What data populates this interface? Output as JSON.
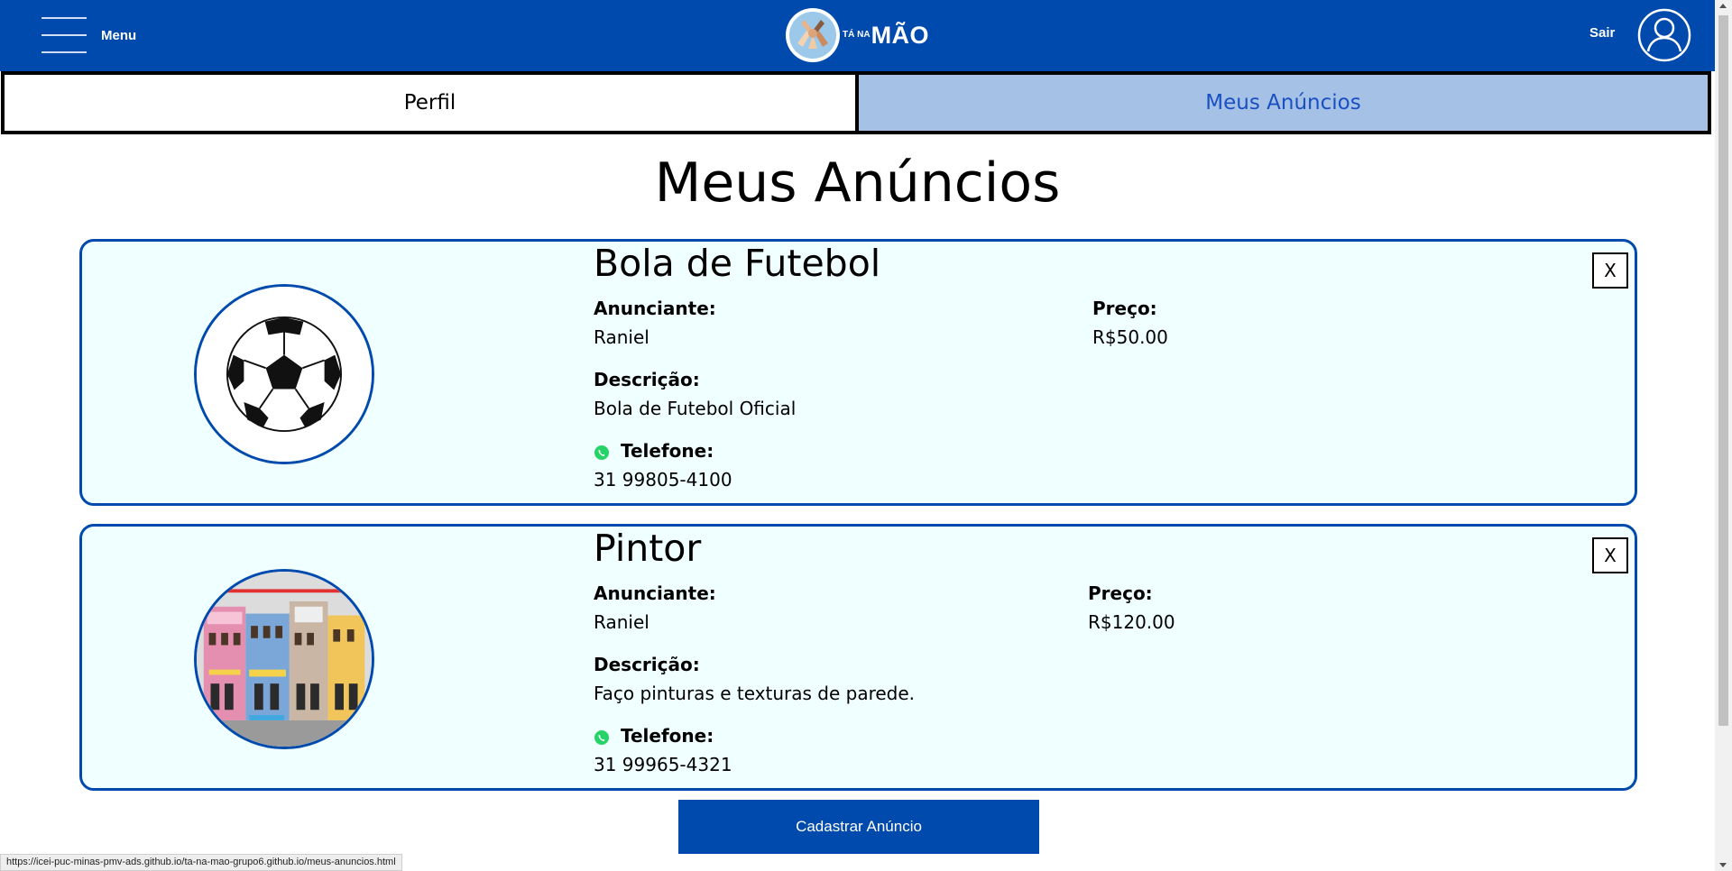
{
  "header": {
    "menu_label": "Menu",
    "logo": {
      "small_text": "TÁ NA",
      "big_text": "MÃO"
    },
    "logout_label": "Sair",
    "user_icon": "user-avatar-icon"
  },
  "tabs": [
    {
      "label": "Perfil",
      "active": false
    },
    {
      "label": "Meus Anúncios",
      "active": true
    }
  ],
  "page_title": "Meus Anúncios",
  "ads": [
    {
      "title": "Bola de Futebol",
      "advertiser_label": "Anunciante:",
      "advertiser": "Raniel",
      "price_label": "Preço:",
      "price": "R$50.00",
      "description_label": "Descrição:",
      "description": "Bola de Futebol Oficial",
      "phone_label": "Telefone:",
      "phone": "31 99805-4100",
      "phone_icon": "whatsapp-icon",
      "image": "soccer-ball",
      "delete_label": "X"
    },
    {
      "title": "Pintor",
      "advertiser_label": "Anunciante:",
      "advertiser": "Raniel",
      "price_label": "Preço:",
      "price": "R$120.00",
      "description_label": "Descrição:",
      "description": "Faço pinturas e texturas de parede.",
      "phone_label": "Telefone:",
      "phone": "31 99965-4321",
      "phone_icon": "whatsapp-icon",
      "image": "colorful-storefronts",
      "delete_label": "X"
    }
  ],
  "cadastrar_label": "Cadastrar Anúncio",
  "status_url": "https://icei-puc-minas-pmv-ads.github.io/ta-na-mao-grupo6.github.io/meus-anuncios.html",
  "colors": {
    "primary": "#004aad",
    "card_bg": "#f0ffff",
    "active_tab_bg": "#a5c2e6",
    "active_tab_text": "#1a4fc2",
    "whatsapp": "#25d366"
  }
}
